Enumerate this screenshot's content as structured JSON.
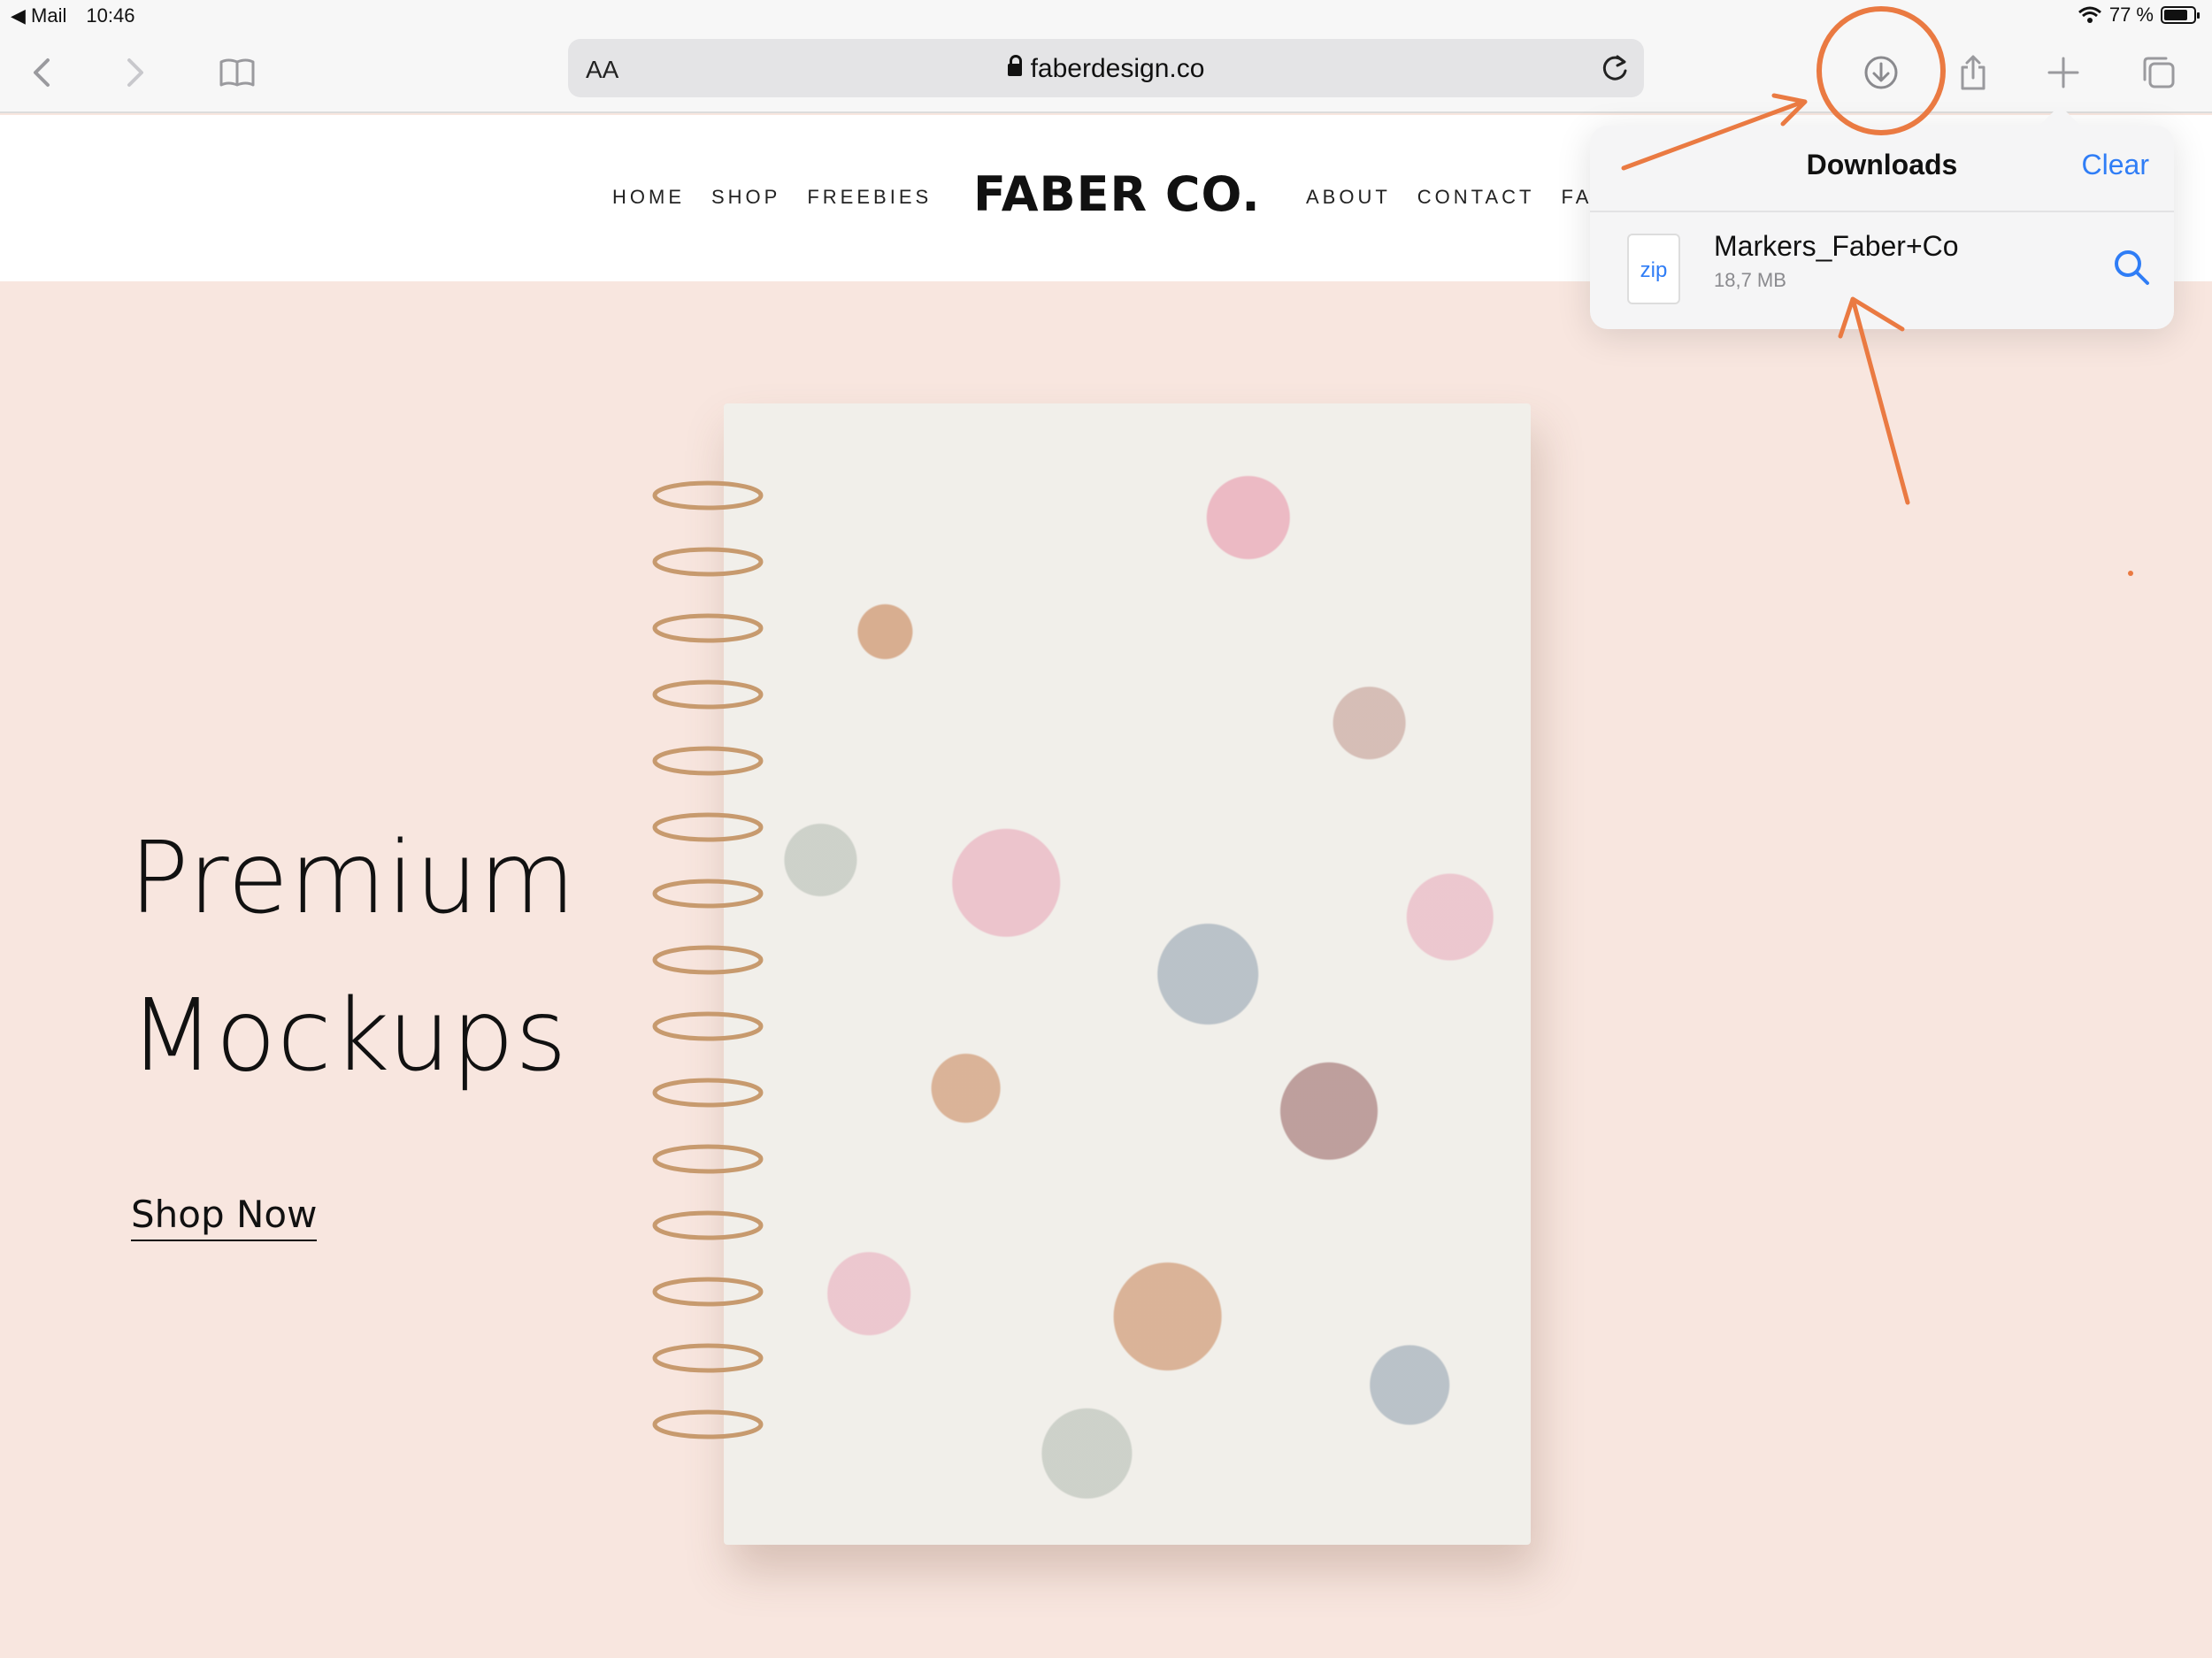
{
  "status_bar": {
    "back_app": "◀ Mail",
    "time": "10:46",
    "battery": "77 %"
  },
  "toolbar": {
    "address_aa": "AA",
    "url": "faberdesign.co"
  },
  "site": {
    "nav_left": [
      "HOME",
      "SHOP",
      "FREEBIES"
    ],
    "logo": "FABER CO.",
    "nav_right": [
      "ABOUT",
      "CONTACT",
      "FAQ"
    ]
  },
  "hero": {
    "title_line1": "Premium",
    "title_line2": "Mockups",
    "cta": "Shop Now"
  },
  "downloads": {
    "title": "Downloads",
    "clear_label": "Clear",
    "items": [
      {
        "icon_label": "zip",
        "name": "Markers_Faber+Co",
        "size": "18,7 MB"
      }
    ]
  },
  "colors": {
    "accent_blue": "#2f7df6",
    "annotation_orange": "#ea7a42",
    "hero_bg": "#f8e6df"
  }
}
